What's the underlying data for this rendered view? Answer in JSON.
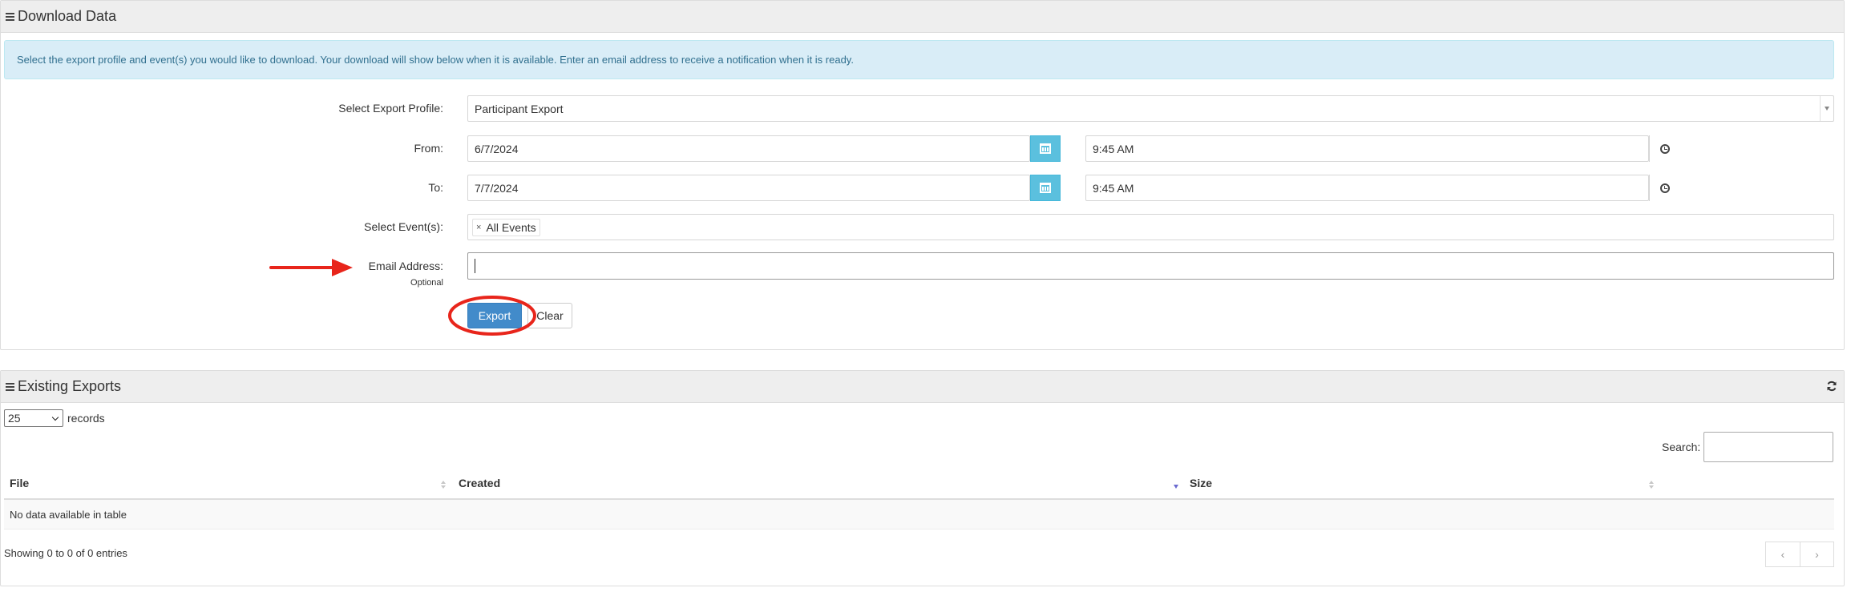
{
  "download_panel": {
    "title": "Download Data",
    "info_message": "Select the export profile and event(s) you would like to download. Your download will show below when it is available. Enter an email address to receive a notification when it is ready.",
    "export_profile": {
      "label": "Select Export Profile:",
      "value": "Participant Export"
    },
    "from": {
      "label": "From:",
      "date": "6/7/2024",
      "time": "9:45 AM"
    },
    "to": {
      "label": "To:",
      "date": "7/7/2024",
      "time": "9:45 AM"
    },
    "events": {
      "label": "Select Event(s):",
      "selected": "All Events",
      "remove_glyph": "×"
    },
    "email": {
      "label": "Email Address:",
      "hint": "Optional",
      "value": ""
    },
    "export_button": "Export",
    "clear_button": "Clear"
  },
  "exports_panel": {
    "title": "Existing Exports",
    "page_length": "25",
    "records_label": "records",
    "search_label": "Search:",
    "columns": [
      "File",
      "Created",
      "Size"
    ],
    "empty_message": "No data available in table",
    "summary": "Showing 0 to 0 of 0 entries",
    "prev_glyph": "‹",
    "next_glyph": "›"
  },
  "colors": {
    "primary": "#428bca",
    "info_bg": "#d9edf7",
    "info_text": "#31708f",
    "calendar_button": "#5bc0de",
    "annotation": "#e8251b"
  },
  "icons": [
    "menu-icon",
    "calendar-icon",
    "clock-icon",
    "refresh-icon",
    "sort-icon",
    "arrow-annotation",
    "circle-annotation"
  ]
}
